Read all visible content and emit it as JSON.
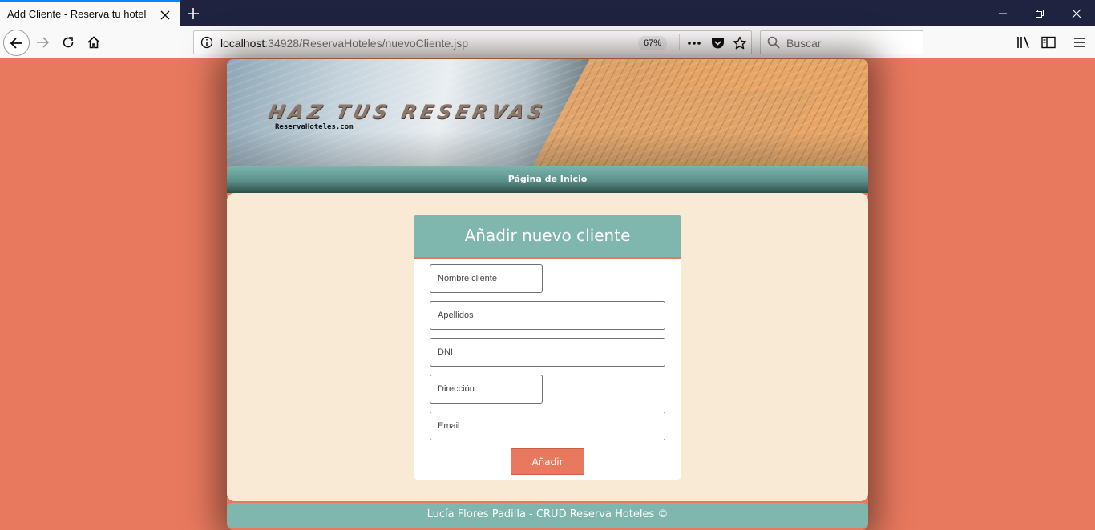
{
  "browser": {
    "tab_title": "Add Cliente - Reserva tu hotel",
    "url_host": "localhost",
    "url_rest": ":34928/ReservaHoteles/nuevoCliente.jsp",
    "zoom": "67%",
    "search_placeholder": "Buscar"
  },
  "banner": {
    "title": "HAZ TUS RESERVAS",
    "subtitle": "ReservaHoteles.com"
  },
  "nav": {
    "home_link": "Página de Inicio"
  },
  "form": {
    "title": "Añadir nuevo cliente",
    "fields": {
      "nombre": "Nombre cliente",
      "apellidos": "Apellidos",
      "dni": "DNI",
      "direccion": "Dirección",
      "email": "Email"
    },
    "submit": "Añadir"
  },
  "footer": {
    "text": "Lucía Flores Padilla - CRUD Reserva Hoteles ©"
  },
  "colors": {
    "page_bg": "#e8795e",
    "teal": "#7fb7ae",
    "content_bg": "#f9ead6",
    "accent": "#e8795e"
  }
}
